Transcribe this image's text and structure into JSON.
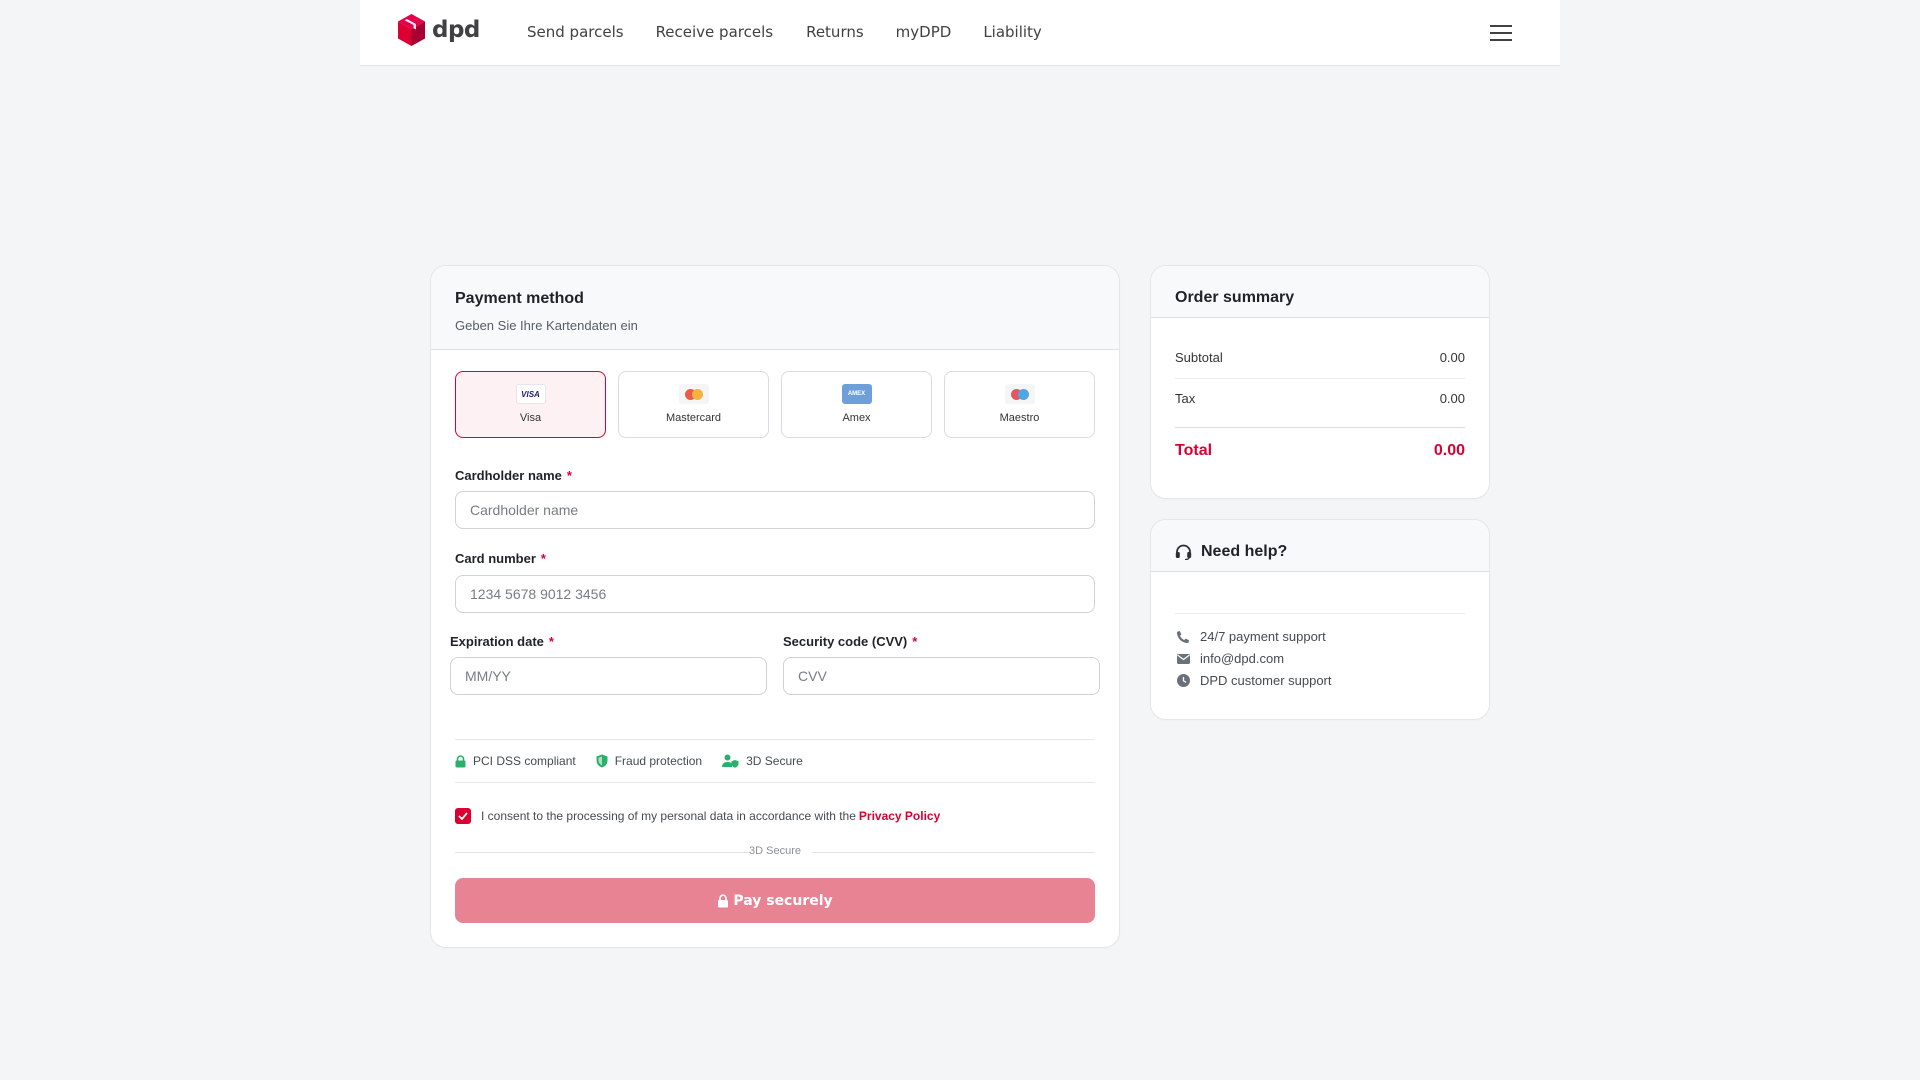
{
  "header": {
    "brand": "dpd",
    "nav": [
      "Send parcels",
      "Receive parcels",
      "Returns",
      "myDPD",
      "Liability"
    ]
  },
  "payment": {
    "title": "Payment method",
    "subtitle": "Geben Sie Ihre Kartendaten ein",
    "methods": [
      {
        "label": "Visa",
        "logo_text": "VISA",
        "selected": true
      },
      {
        "label": "Mastercard",
        "selected": false
      },
      {
        "label": "Amex",
        "logo_text": "AMEX",
        "selected": false
      },
      {
        "label": "Maestro",
        "selected": false
      }
    ],
    "cardholder": {
      "label": "Cardholder name",
      "placeholder": "Cardholder name",
      "value": ""
    },
    "card_number": {
      "label": "Card number",
      "placeholder": "1234 5678 9012 3456",
      "value": ""
    },
    "expiration": {
      "label": "Expiration date",
      "placeholder": "MM/YY",
      "value": ""
    },
    "cvv": {
      "label": "Security code (CVV)",
      "placeholder": "CVV",
      "value": ""
    },
    "required_mark": "*",
    "badges": [
      "PCI DSS compliant",
      "Fraud protection",
      "3D Secure"
    ],
    "consent": {
      "checked": true,
      "text": "I consent to the processing of my personal data in accordance with the",
      "link": "Privacy Policy"
    },
    "separator": "3D Secure",
    "pay_button": "Pay securely"
  },
  "order": {
    "title": "Order summary",
    "subtotal_label": "Subtotal",
    "subtotal_value": "0.00",
    "tax_label": "Tax",
    "tax_value": "0.00",
    "total_label": "Total",
    "total_value": "0.00"
  },
  "help": {
    "title": "Need help?",
    "items": [
      "24/7 payment support",
      "info@dpd.com",
      "DPD customer support"
    ]
  },
  "colors": {
    "brand": "#dc0032",
    "pay_button": "#e88394",
    "badge_icon": "#2bb06b"
  },
  "icons": [
    "dpd-cube-icon",
    "hamburger-menu-icon",
    "lock-icon",
    "shield-icon",
    "user-shield-icon",
    "check-icon",
    "headset-icon",
    "phone-icon",
    "mail-icon",
    "clock-icon"
  ]
}
